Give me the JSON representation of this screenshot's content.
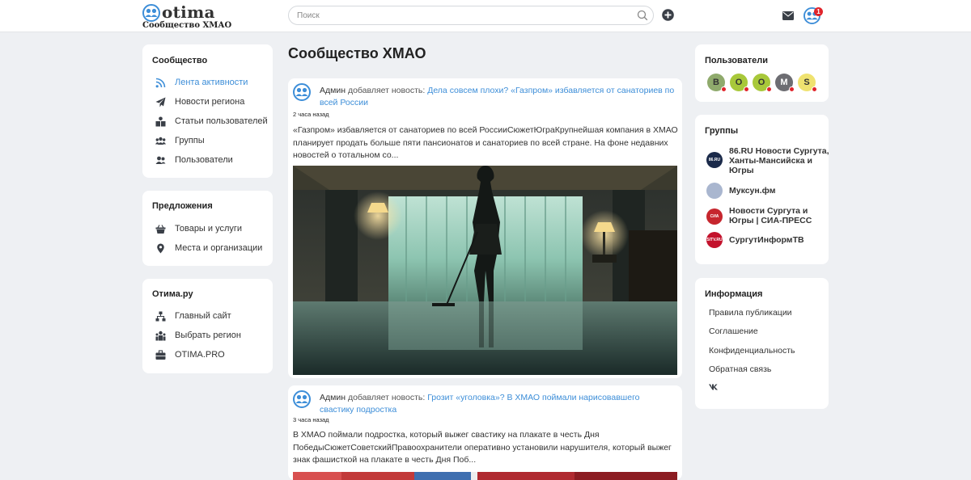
{
  "header": {
    "logo_text": "otima",
    "logo_subtitle": "Сообщество ХМАО",
    "search_placeholder": "Поиск",
    "notification_count": "1"
  },
  "left_sidebar": {
    "community": {
      "title": "Сообщество",
      "items": [
        {
          "label": "Лента активности",
          "icon": "rss-icon",
          "active": true
        },
        {
          "label": "Новости региона",
          "icon": "paper-plane-icon"
        },
        {
          "label": "Статьи пользователей",
          "icon": "articles-icon"
        },
        {
          "label": "Группы",
          "icon": "groups-icon"
        },
        {
          "label": "Пользователи",
          "icon": "users-icon"
        }
      ]
    },
    "offers": {
      "title": "Предложения",
      "items": [
        {
          "label": "Товары и услуги",
          "icon": "basket-icon"
        },
        {
          "label": "Места и организации",
          "icon": "map-pin-icon"
        }
      ]
    },
    "otima": {
      "title": "Отима.ру",
      "items": [
        {
          "label": "Главный сайт",
          "icon": "sitemap-icon"
        },
        {
          "label": "Выбрать регион",
          "icon": "region-icon"
        },
        {
          "label": "OTIMA.PRO",
          "icon": "briefcase-icon"
        }
      ]
    }
  },
  "main": {
    "page_title": "Сообщество ХМАО",
    "posts": [
      {
        "author": "Админ",
        "action": "добавляет новость:",
        "title": "Дела совсем плохи? «Газпром» избавляется от санаториев по всей России",
        "time": "2 часа назад",
        "excerpt": "«Газпром» избавляется от санаториев по всей РоссииСюжетЮграКрупнейшая компания в ХМАО планирует продать больше пяти пансионатов и санаториев по всей стране. На фоне недавних новостей о тотальном со..."
      },
      {
        "author": "Админ",
        "action": "добавляет новость:",
        "title": "Грозит «уголовка»? В ХМАО поймали нарисовавшего свастику подростка",
        "time": "3 часа назад",
        "excerpt": "В ХМАО поймали подростка, который выжег свастику на плакате в честь Дня ПобедыСюжетСоветскийПравоохранители оперативно установили нарушителя, который выжег знак фашисткой на плакате в честь Дня Поб..."
      }
    ]
  },
  "right_sidebar": {
    "users": {
      "title": "Пользователи",
      "list": [
        {
          "letter": "B",
          "color": "#8faa6c"
        },
        {
          "letter": "O",
          "color": "#a8c83a"
        },
        {
          "letter": "O",
          "color": "#a8c83a"
        },
        {
          "letter": "M",
          "color": "#6d6d72"
        },
        {
          "letter": "S",
          "color": "#efe270"
        }
      ]
    },
    "groups": {
      "title": "Группы",
      "list": [
        {
          "name": "86.RU Новости Сургута, Ханты-Мансийска и Югры",
          "logo_text": "86.RU",
          "color": "#1b2a4a"
        },
        {
          "name": "Муксун.фм",
          "logo_text": "",
          "color": "#a9b6cf"
        },
        {
          "name": "Новости Сургута и Югры | СИА-ПРЕСС",
          "logo_text": "СИА ПРЕСС",
          "color": "#c6262e"
        },
        {
          "name": "СургутИнформТВ",
          "logo_text": "SITV.RU",
          "color": "#c3122c"
        }
      ]
    },
    "info": {
      "title": "Информация",
      "links": [
        "Правила публикации",
        "Соглашение",
        "Конфиденциальность",
        "Обратная связь"
      ],
      "social": "vk-icon"
    }
  },
  "colors": {
    "accent": "#3d8ed8",
    "background": "#eef0f3",
    "badge": "#e0242b"
  }
}
